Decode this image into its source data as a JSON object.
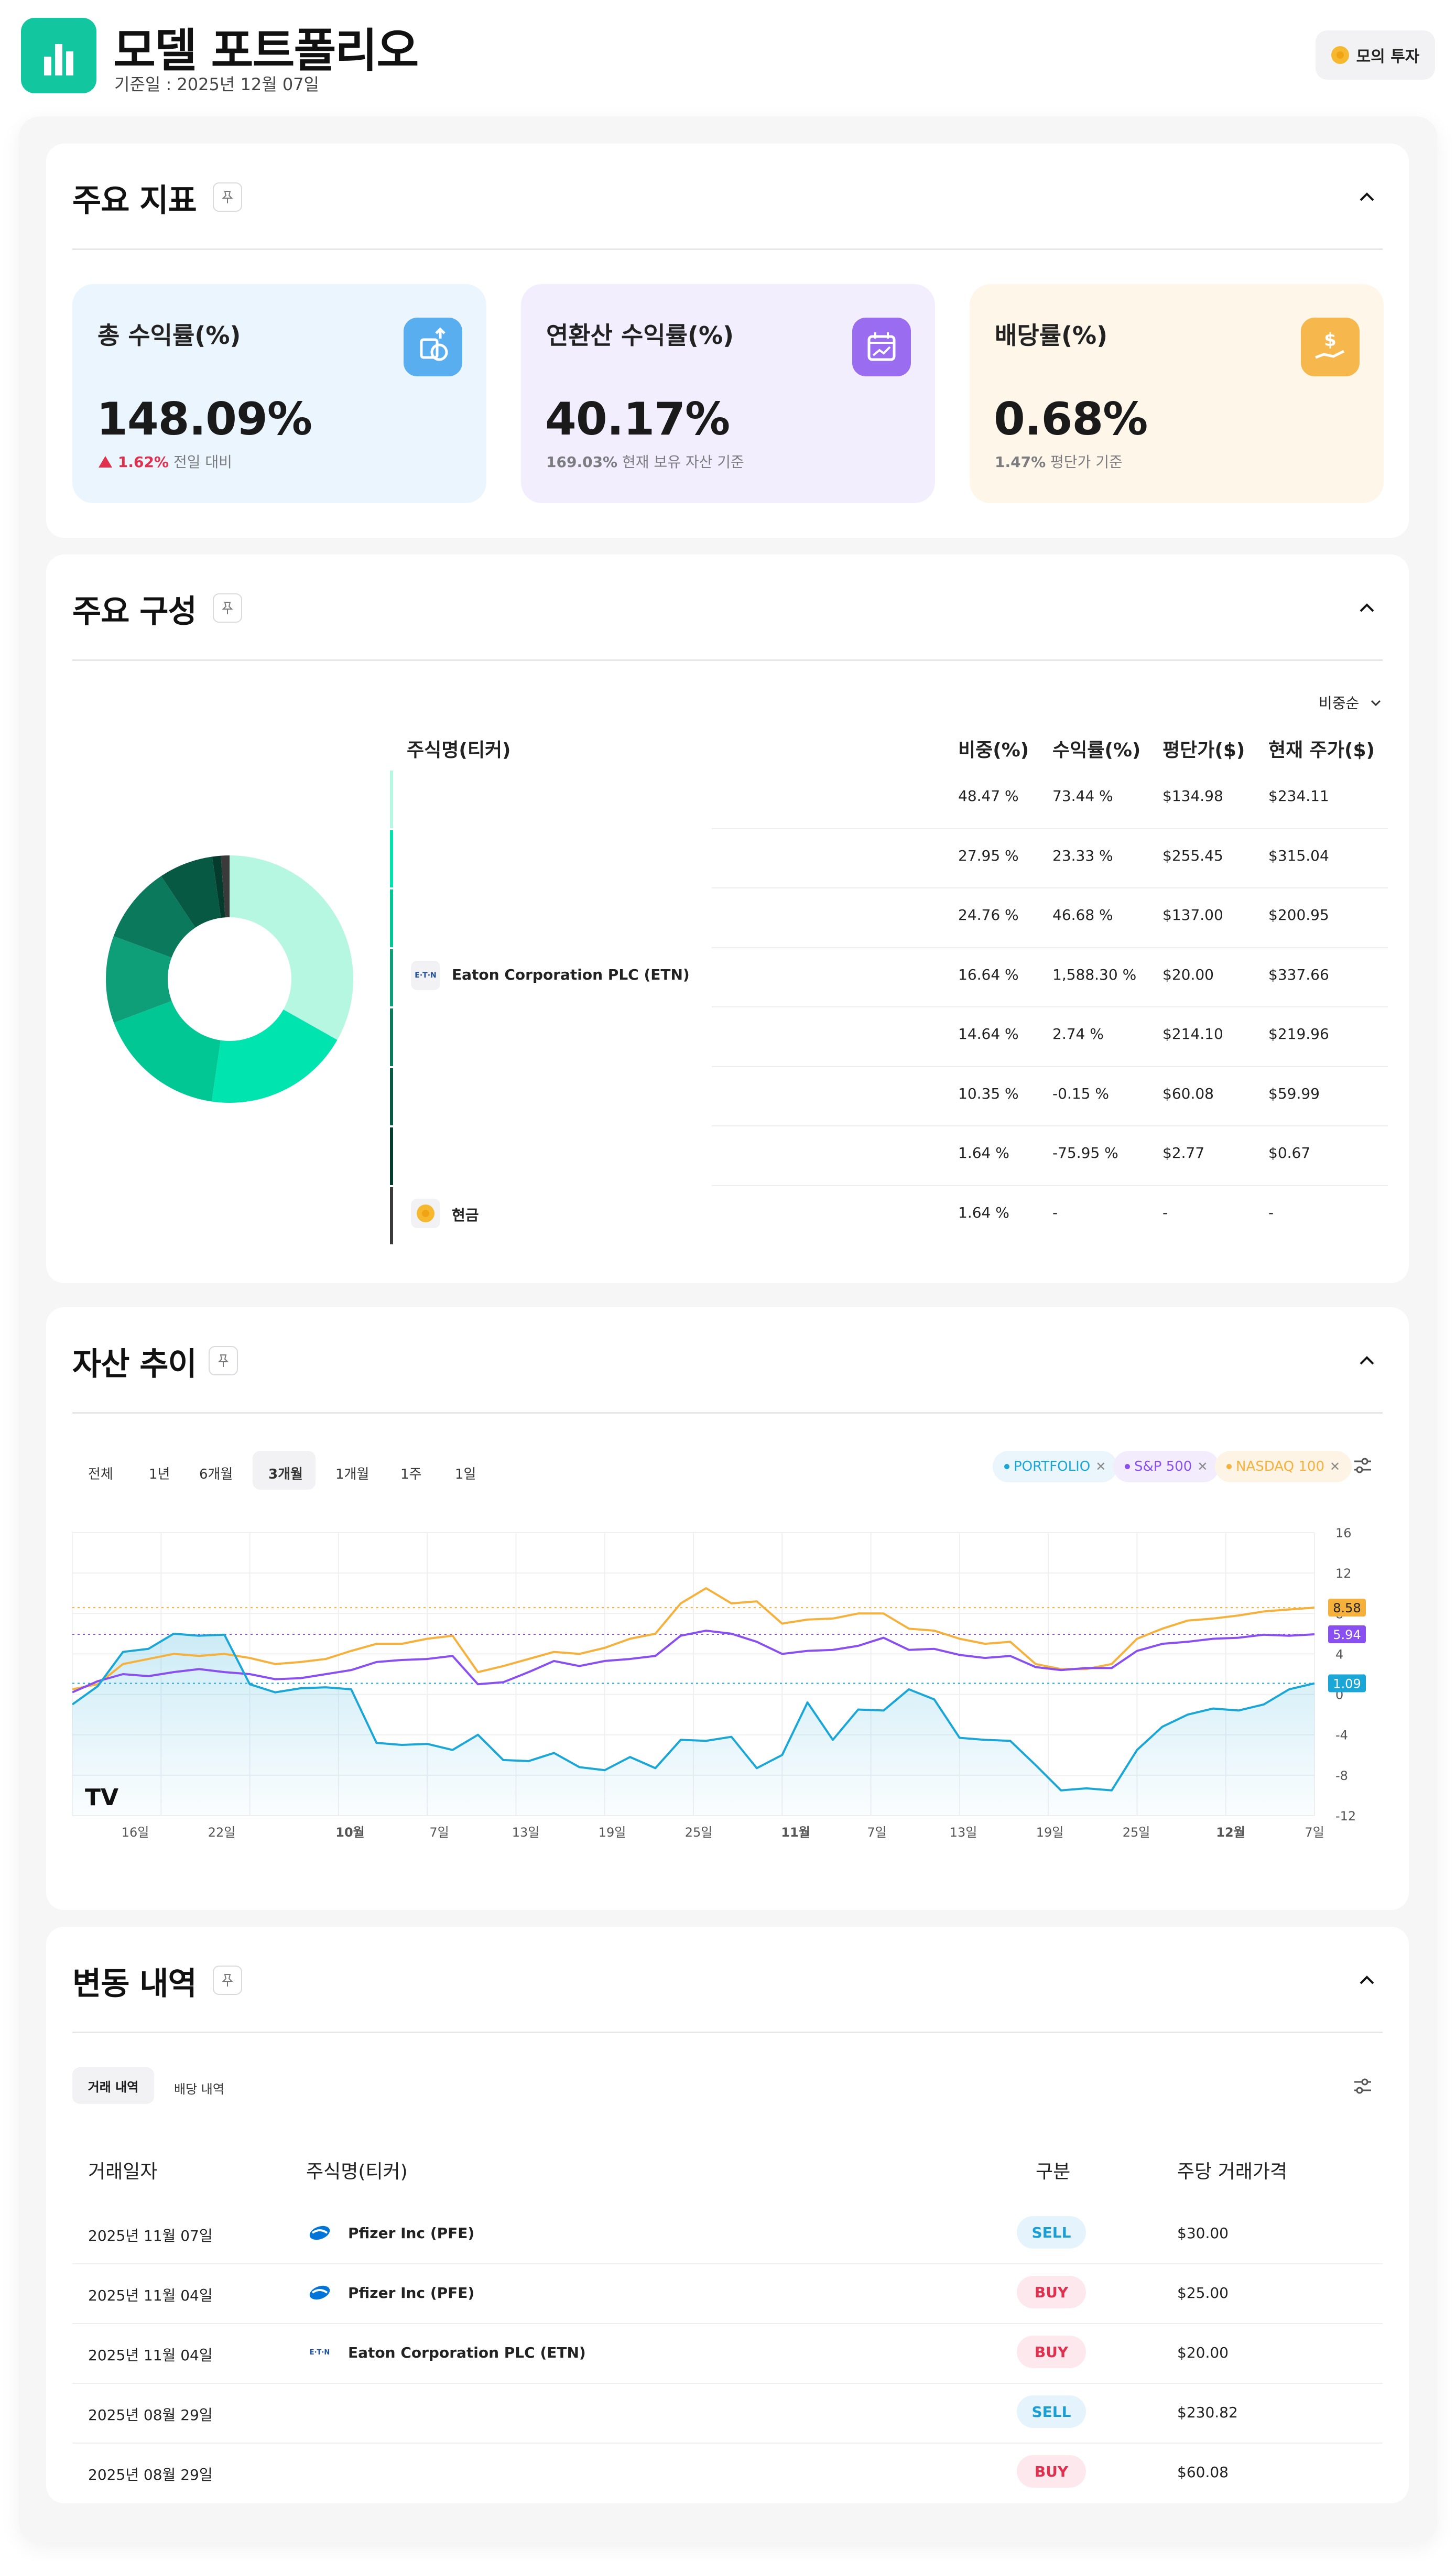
{
  "header": {
    "title": "모델 포트폴리오",
    "date": "기준일 : 2025년 12월 07일",
    "mock_button": "모의 투자"
  },
  "sections": {
    "metrics_title": "주요 지표",
    "composition_title": "주요 구성",
    "trend_title": "자산 추이",
    "history_title": "변동 내역"
  },
  "metrics": [
    {
      "label": "총 수익률(%)",
      "value": "148.09%",
      "sub_value": "1.62%",
      "sub_text": "전일 대비",
      "icon": "money-up-icon",
      "bg": "#eaf5fd",
      "icon_color": "#58aeef",
      "sub_color": "#e0304e"
    },
    {
      "label": "연환산 수익률(%)",
      "value": "40.17%",
      "sub_value": "169.03%",
      "sub_text": "현재 보유 자산 기준",
      "icon": "calendar-chart-icon",
      "bg": "#f3eefe",
      "icon_color": "#9a6cf0",
      "sub_color": "#7b7b80"
    },
    {
      "label": "배당률(%)",
      "value": "0.68%",
      "sub_value": "1.47%",
      "sub_text": "평단가 기준",
      "icon": "dividend-hand-icon",
      "bg": "#fef7e9",
      "icon_color": "#f6b84c",
      "sub_color": "#7b7b80"
    }
  ],
  "composition": {
    "sort_label": "비중순",
    "headers": [
      "주식명(티커)",
      "비중(%)",
      "수익률(%)",
      "평단가($)",
      "현재 주가($)"
    ],
    "rows": [
      {
        "name": "",
        "weight": "48.47 %",
        "return": "73.44 %",
        "avg": "$134.98",
        "price": "$234.11",
        "color": "#b5f7e0"
      },
      {
        "name": "",
        "weight": "27.95 %",
        "return": "23.33 %",
        "avg": "$255.45",
        "price": "$315.04",
        "color": "#00e4b0"
      },
      {
        "name": "",
        "weight": "24.76 %",
        "return": "46.68 %",
        "avg": "$137.00",
        "price": "$200.95",
        "color": "#00c794"
      },
      {
        "name": "Eaton Corporation PLC (ETN)",
        "weight": "16.64 %",
        "return": "1,588.30 %",
        "avg": "$20.00",
        "price": "$337.66",
        "color": "#0e9e78"
      },
      {
        "name": "",
        "weight": "14.64 %",
        "return": "2.74 %",
        "avg": "$214.10",
        "price": "$219.96",
        "color": "#0b7a5c"
      },
      {
        "name": "",
        "weight": "10.35 %",
        "return": "-0.15 %",
        "avg": "$60.08",
        "price": "$59.99",
        "color": "#075943"
      },
      {
        "name": "",
        "weight": "1.64 %",
        "return": "-75.95 %",
        "avg": "$2.77",
        "price": "$0.67",
        "color": "#043b2d"
      },
      {
        "name": "현금",
        "weight": "1.64 %",
        "return": "-",
        "avg": "-",
        "price": "-",
        "color": "#3a3a3a"
      }
    ]
  },
  "trend": {
    "tabs": [
      "전체",
      "1년",
      "6개월",
      "3개월",
      "1개월",
      "1주",
      "1일"
    ],
    "active_tab": "3개월",
    "legend": [
      {
        "name": "PORTFOLIO",
        "color": "#1aa6d6",
        "bg": "#eaf6fc"
      },
      {
        "name": "S&P 500",
        "color": "#8a4ff0",
        "bg": "#f2ecfd"
      },
      {
        "name": "NASDAQ 100",
        "color": "#f5b13c",
        "bg": "#fdf4e6"
      }
    ],
    "y_ticks": [
      "16",
      "12",
      "8",
      "4",
      "0",
      "-4",
      "-8",
      "-12"
    ],
    "x_ticks": [
      "16일",
      "22일",
      "10월",
      "7일",
      "13일",
      "19일",
      "25일",
      "11월",
      "7일",
      "13일",
      "19일",
      "25일",
      "12월",
      "7일"
    ],
    "end_labels": {
      "nasdaq": "8.58",
      "sp500": "5.94",
      "portfolio": "1.09"
    },
    "watermark": "TV"
  },
  "chart_data": {
    "type": "line",
    "ylim": [
      -12,
      16
    ],
    "series": [
      {
        "name": "PORTFOLIO",
        "values": [
          -1.0,
          0.8,
          4.2,
          4.5,
          6.0,
          5.8,
          5.9,
          1.0,
          0.2,
          0.6,
          0.7,
          0.5,
          -4.8,
          -5.0,
          -4.9,
          -5.5,
          -4.0,
          -6.5,
          -6.6,
          -5.8,
          -7.2,
          -7.5,
          -6.2,
          -7.3,
          -4.5,
          -4.6,
          -4.2,
          -7.3,
          -6.0,
          -0.8,
          -4.5,
          -1.5,
          -1.6,
          0.5,
          -0.5,
          -4.3,
          -4.5,
          -4.6,
          -7.0,
          -9.5,
          -9.3,
          -9.5,
          -5.5,
          -3.2,
          -2.0,
          -1.4,
          -1.6,
          -1.0,
          0.5,
          1.09
        ]
      },
      {
        "name": "S&P 500",
        "values": [
          0.2,
          1.3,
          2.0,
          1.8,
          2.2,
          2.5,
          2.2,
          2.0,
          1.5,
          1.6,
          2.0,
          2.4,
          3.2,
          3.4,
          3.5,
          3.8,
          1.0,
          1.2,
          2.2,
          3.3,
          2.8,
          3.3,
          3.5,
          3.8,
          5.8,
          6.3,
          6.0,
          5.2,
          4.0,
          4.3,
          4.4,
          4.8,
          5.6,
          4.4,
          4.5,
          3.9,
          3.6,
          3.8,
          2.7,
          2.4,
          2.6,
          2.6,
          4.3,
          5.0,
          5.2,
          5.5,
          5.6,
          5.9,
          5.8,
          5.94
        ]
      },
      {
        "name": "NASDAQ 100",
        "values": [
          0.5,
          1.0,
          3.0,
          3.5,
          4.0,
          3.8,
          4.0,
          3.6,
          3.0,
          3.2,
          3.5,
          4.3,
          5.0,
          5.0,
          5.5,
          5.8,
          2.2,
          2.8,
          3.5,
          4.2,
          4.0,
          4.6,
          5.5,
          6.0,
          9.0,
          10.5,
          9.0,
          9.2,
          7.0,
          7.4,
          7.5,
          8.0,
          8.0,
          6.5,
          6.3,
          5.5,
          5.0,
          5.2,
          3.0,
          2.5,
          2.5,
          3.0,
          5.5,
          6.5,
          7.3,
          7.5,
          7.8,
          8.2,
          8.4,
          8.58
        ]
      }
    ]
  },
  "history": {
    "tabs": [
      "거래 내역",
      "배당 내역"
    ],
    "headers": [
      "거래일자",
      "주식명(티커)",
      "구분",
      "주당 거래가격"
    ],
    "rows": [
      {
        "date": "2025년 11월 07일",
        "name": "Pfizer Inc (PFE)",
        "type": "SELL",
        "price": "$30.00",
        "logo": "pfizer-logo-icon"
      },
      {
        "date": "2025년 11월 04일",
        "name": "Pfizer Inc (PFE)",
        "type": "BUY",
        "price": "$25.00",
        "logo": "pfizer-logo-icon"
      },
      {
        "date": "2025년 11월 04일",
        "name": "Eaton Corporation PLC (ETN)",
        "type": "BUY",
        "price": "$20.00",
        "logo": "eaton-logo-icon"
      },
      {
        "date": "2025년 08월 29일",
        "name": "",
        "type": "SELL",
        "price": "$230.82",
        "logo": ""
      },
      {
        "date": "2025년 08월 29일",
        "name": "",
        "type": "BUY",
        "price": "$60.08",
        "logo": ""
      }
    ]
  }
}
